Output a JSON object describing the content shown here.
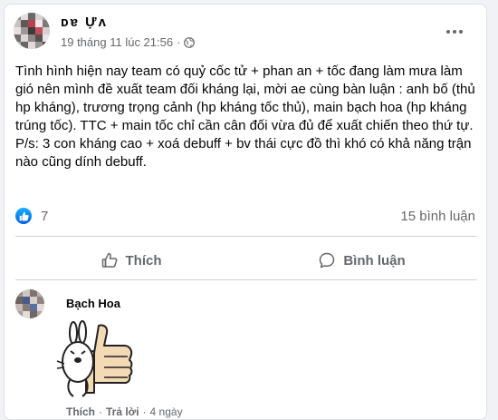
{
  "post": {
    "author_name": "ᴅɐ Ựʌ",
    "timestamp": "19 tháng 11 lúc 21:56",
    "separator": "·",
    "body": "Tình hình hiện nay team có quỷ cốc tử + phan an + tốc đang làm mưa làm gió nên mình đề xuất team đối kháng lại, mời ae cùng bàn luận : anh bố (thủ hp kháng), trương trọng cảnh (hp kháng tốc thủ), main bạch hoa (hp kháng trúng tốc). TTC + main tốc chỉ cần cân đối vừa đủ để xuất chiến theo thứ tự.\nP/s: 3 con kháng cao + xoá debuff + bv thái cực đồ thì khó có khả năng trận nào cũng dính debuff.",
    "reaction_count": "7",
    "comment_count": "15 bình luận"
  },
  "actions": {
    "like_label": "Thích",
    "comment_label": "Bình luận"
  },
  "comment": {
    "author_name": "Bạch Hoa",
    "like_label": "Thích",
    "reply_label": "Trả lời",
    "age": "4 ngày",
    "separator": "·"
  },
  "colors": {
    "accent": "#1877f2",
    "secondary_text": "#65676b",
    "background": "#f0f2f5"
  },
  "icons": {
    "privacy": "globe-icon",
    "more": "more-options-icon",
    "reaction": "like-badge-icon",
    "like": "thumbs-up-icon",
    "comment": "speech-bubble-icon"
  }
}
